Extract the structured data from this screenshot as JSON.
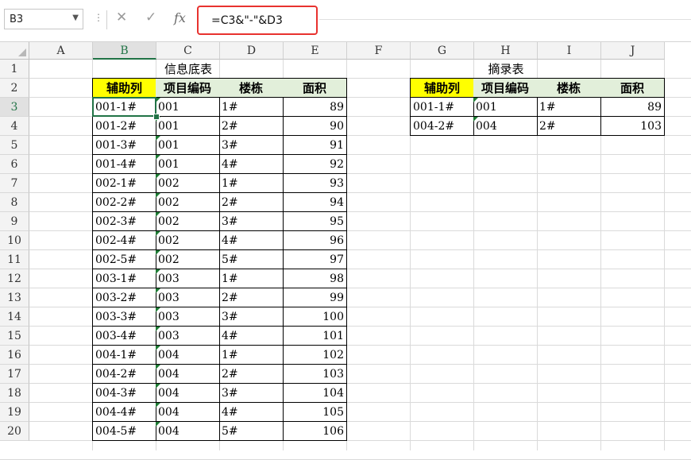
{
  "formula_bar": {
    "name_box": "B3",
    "formula": "=C3&\"-\"&D3",
    "fx_label": "fx",
    "cancel_icon": "close-icon",
    "confirm_icon": "check-icon"
  },
  "columns": [
    "A",
    "B",
    "C",
    "D",
    "E",
    "F",
    "G",
    "H",
    "I",
    "J"
  ],
  "rows": [
    "1",
    "2",
    "3",
    "4",
    "5",
    "6",
    "7",
    "8",
    "9",
    "10",
    "11",
    "12",
    "13",
    "14",
    "15",
    "16",
    "17",
    "18",
    "19",
    "20"
  ],
  "active_cell": {
    "col": "B",
    "row": "3"
  },
  "source_table": {
    "title": "信息底表",
    "headers": [
      "辅助列",
      "项目编码",
      "楼栋",
      "面积"
    ],
    "rows": [
      [
        "001-1#",
        "001",
        "1#",
        "89"
      ],
      [
        "001-2#",
        "001",
        "2#",
        "90"
      ],
      [
        "001-3#",
        "001",
        "3#",
        "91"
      ],
      [
        "001-4#",
        "001",
        "4#",
        "92"
      ],
      [
        "002-1#",
        "002",
        "1#",
        "93"
      ],
      [
        "002-2#",
        "002",
        "2#",
        "94"
      ],
      [
        "002-3#",
        "002",
        "3#",
        "95"
      ],
      [
        "002-4#",
        "002",
        "4#",
        "96"
      ],
      [
        "002-5#",
        "002",
        "5#",
        "97"
      ],
      [
        "003-1#",
        "003",
        "1#",
        "98"
      ],
      [
        "003-2#",
        "003",
        "2#",
        "99"
      ],
      [
        "003-3#",
        "003",
        "3#",
        "100"
      ],
      [
        "003-4#",
        "003",
        "4#",
        "101"
      ],
      [
        "004-1#",
        "004",
        "1#",
        "102"
      ],
      [
        "004-2#",
        "004",
        "2#",
        "103"
      ],
      [
        "004-3#",
        "004",
        "3#",
        "104"
      ],
      [
        "004-4#",
        "004",
        "4#",
        "105"
      ],
      [
        "004-5#",
        "004",
        "5#",
        "106"
      ]
    ]
  },
  "extract_table": {
    "title": "摘录表",
    "headers": [
      "辅助列",
      "项目编码",
      "楼栋",
      "面积"
    ],
    "rows": [
      [
        "001-1#",
        "001",
        "1#",
        "89"
      ],
      [
        "004-2#",
        "004",
        "2#",
        "103"
      ]
    ]
  },
  "colors": {
    "header_yellow": "#ffff00",
    "header_green": "#e2efda",
    "selection_green": "#217346",
    "highlight_red": "#e8322f"
  }
}
